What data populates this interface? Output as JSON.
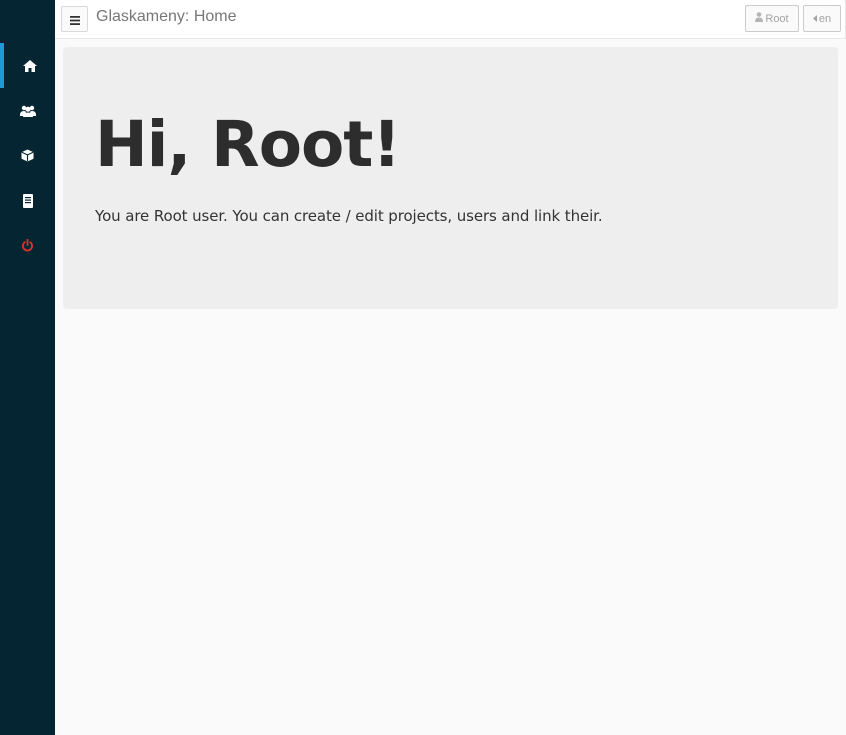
{
  "header": {
    "title": "Glaskameny: Home",
    "user_button_label": "Root",
    "language_button_label": "en"
  },
  "sidebar": {
    "items": [
      {
        "icon": "home-icon",
        "active": true
      },
      {
        "icon": "users-icon",
        "active": false
      },
      {
        "icon": "cube-icon",
        "active": false
      },
      {
        "icon": "document-icon",
        "active": false
      },
      {
        "icon": "power-icon",
        "active": false
      }
    ]
  },
  "jumbotron": {
    "heading": "Hi, Root!",
    "text": "You are Root user. You can create / edit projects, users and link their."
  },
  "colors": {
    "sidebar_bg": "#062532",
    "active_indicator": "#1e9bd7",
    "power_icon": "#d9332f",
    "jumbotron_bg": "#eeeeee"
  }
}
